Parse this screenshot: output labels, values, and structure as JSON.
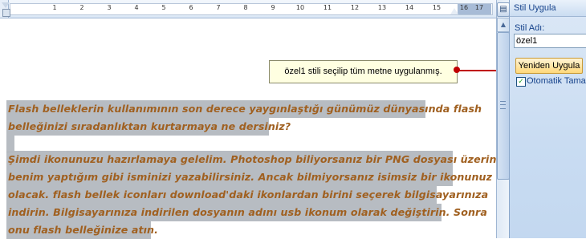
{
  "ruler": {
    "numbers": [
      "1",
      "2",
      "3",
      "4",
      "5",
      "6",
      "7",
      "8",
      "9",
      "10",
      "11",
      "12",
      "13",
      "14",
      "15",
      "16",
      "17"
    ]
  },
  "document": {
    "lines": [
      "Flash belleklerin kullanımının son derece yaygınlaştığı günümüz dünyasında flash",
      "belleğinizi sıradanlıktan kurtarmaya ne dersiniz?",
      "",
      "Şimdi ikonunuzu hazırlamaya gelelim. Photoshop biliyorsanız bir PNG dosyası üzerine",
      "benim yaptığım gibi isminizi yazabilirsiniz. Ancak bilmiyorsanız isimsiz bir ikonunuz",
      "olacak. flash bellek iconları download'daki ikonlardan birini seçerek bilgisayarınıza",
      "indirin. Bilgisayarınıza indirilen dosyanın adını usb ikonum olarak değiştirin. Sonra",
      "onu flash belleğinize atın."
    ],
    "text_color": "#a06020",
    "selection_color": "#b3b8bf"
  },
  "callout": {
    "text": "özel1 stili seçilip tüm metne uygulanmış.",
    "arrow_color": "#c00000"
  },
  "pane": {
    "title": "Stil Uygula",
    "style_name_label": "Stil Adı:",
    "style_name_value": "özel1",
    "reapply_label": "Yeniden Uygula",
    "auto_update_label": "Otomatik Tamamla",
    "auto_update_checked": true
  },
  "icons": {
    "pane": "style-pane-icon",
    "ruler_toggle": "ruler-toggle-icon",
    "scroll_up": "chevron-up-icon"
  }
}
